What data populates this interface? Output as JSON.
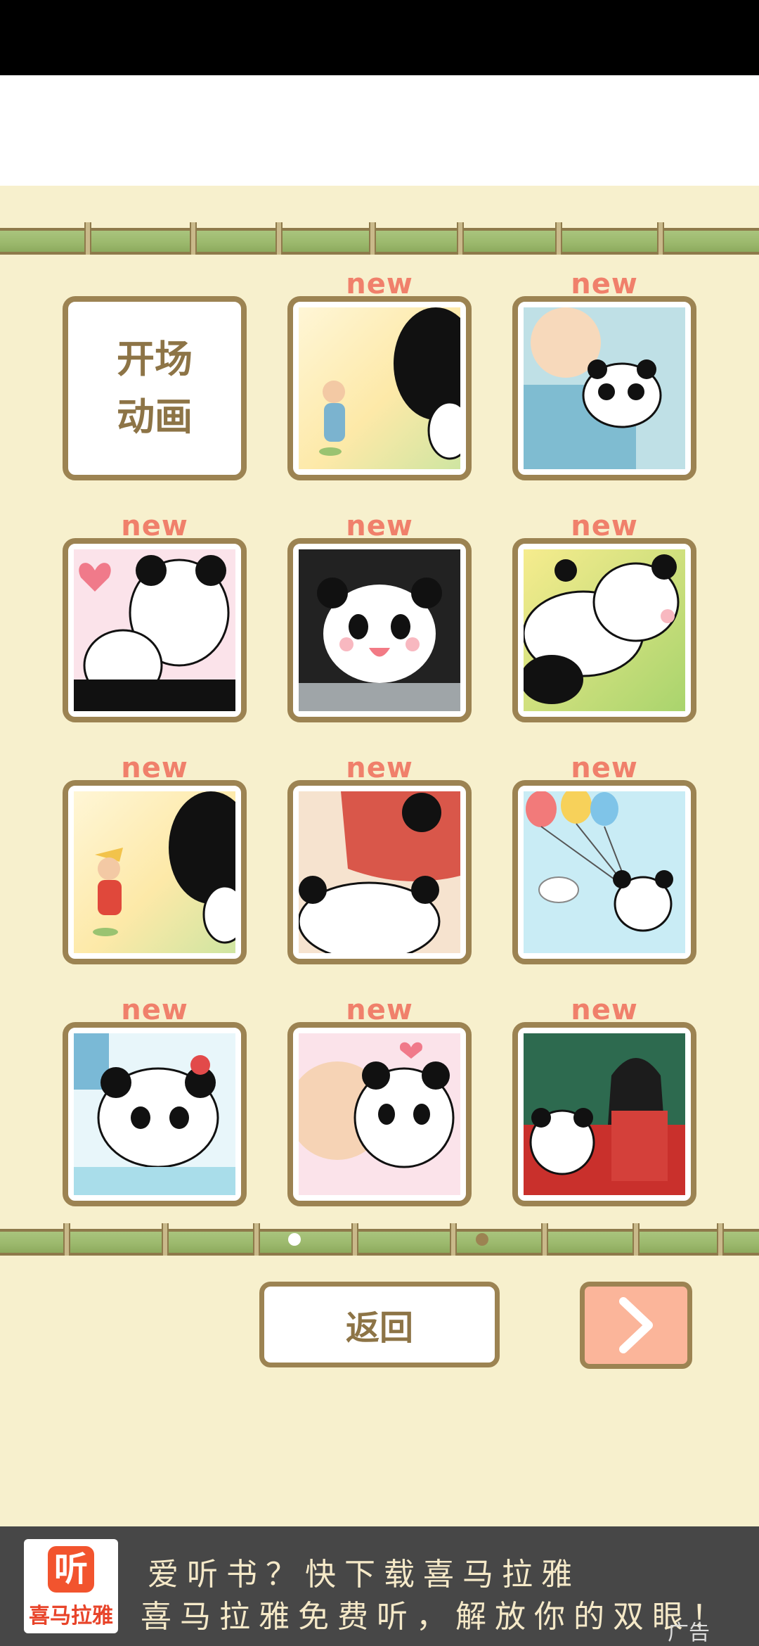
{
  "page": {
    "new_badge": "new",
    "tiles": [
      {
        "type": "text",
        "line1": "开场",
        "line2": "动画",
        "new": false
      },
      {
        "type": "image",
        "scene": "old-man-waving-panda",
        "new": true
      },
      {
        "type": "image",
        "scene": "old-man-hugging-panda",
        "new": true
      },
      {
        "type": "image",
        "scene": "panda-mother-cub-heart",
        "new": true
      },
      {
        "type": "image",
        "scene": "panda-in-bowl-sparkles",
        "new": true
      },
      {
        "type": "image",
        "scene": "panda-lying-on-grass",
        "new": true
      },
      {
        "type": "image",
        "scene": "boy-running-to-panda",
        "new": true
      },
      {
        "type": "image",
        "scene": "man-in-red-with-panda",
        "new": true
      },
      {
        "type": "image",
        "scene": "panda-with-balloons-bird",
        "new": true
      },
      {
        "type": "image",
        "scene": "panda-with-bow-sweating",
        "new": true
      },
      {
        "type": "image",
        "scene": "kiss-panda-heart",
        "new": true
      },
      {
        "type": "image",
        "scene": "panda-with-kimono-girl",
        "new": true
      }
    ],
    "pager": {
      "current": 1,
      "total": 2
    },
    "back_label": "返回",
    "next_icon": "chevron-right-icon"
  },
  "ad": {
    "brand": "喜马拉雅",
    "logo_glyph": "听",
    "line1": "爱听书？快下载喜马拉雅",
    "line2": "喜马拉雅免费听，解放你的双眼！",
    "tag": "广告"
  },
  "colors": {
    "background": "#f7f0cd",
    "frame": "#9c8352",
    "new_text": "#f0806b",
    "next_button": "#fbb59a",
    "bamboo": "#9bb86c"
  }
}
